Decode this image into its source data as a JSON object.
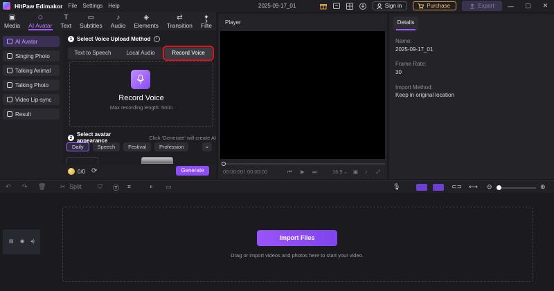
{
  "app": {
    "name": "HitPaw Edimakor",
    "menu": [
      "File",
      "Settings",
      "Help"
    ],
    "document_title": "2025-09-17_01",
    "sign_in_label": "Sign in",
    "purchase_label": "Purchase",
    "export_label": "Export"
  },
  "tool_tabs": [
    {
      "label": "Media",
      "icon": "media-icon"
    },
    {
      "label": "AI Avatar",
      "icon": "ai-avatar-icon",
      "active": true
    },
    {
      "label": "Text",
      "icon": "text-icon"
    },
    {
      "label": "Subtitles",
      "icon": "subtitles-icon"
    },
    {
      "label": "Audio",
      "icon": "audio-icon"
    },
    {
      "label": "Elements",
      "icon": "elements-icon"
    },
    {
      "label": "Transition",
      "icon": "transition-icon"
    },
    {
      "label": "Filte",
      "icon": "filter-icon"
    }
  ],
  "sidebar": {
    "items": [
      {
        "label": "AI Avatar",
        "active": true
      },
      {
        "label": "Singing Photo"
      },
      {
        "label": "Talking Animal"
      },
      {
        "label": "Talking Photo"
      },
      {
        "label": "Video Lip-sync"
      },
      {
        "label": "Result"
      }
    ]
  },
  "avatar_panel": {
    "step1_number": "1",
    "step1_title": "Select Voice Upload Method",
    "methods": [
      "Text to Speech",
      "Local Audio",
      "Record Voice"
    ],
    "selected_method": "Record Voice",
    "record_title": "Record Voice",
    "record_subtitle": "Max recording length: 5min",
    "step2_number": "2",
    "step2_title": "Select avatar appearance",
    "step2_hint": "Click 'Generate' will create AI",
    "categories": [
      "Daily",
      "Speech",
      "Festival",
      "Profession"
    ],
    "active_category": "Daily",
    "credits": "0/0",
    "generate_label": "Generate"
  },
  "player": {
    "title": "Player",
    "current_time": "00:00:00",
    "total_time": "00:00:00",
    "aspect_ratio": "16:9"
  },
  "details": {
    "tab_label": "Details",
    "fields": [
      {
        "label": "Name:",
        "value": "2025-09-17_01"
      },
      {
        "label": "Frame Rate:",
        "value": "30"
      },
      {
        "label": "Import Method:",
        "value": "Keep in original location"
      }
    ]
  },
  "timeline": {
    "split_label": "Split",
    "import_label": "Import Files",
    "drop_hint": "Drag or import videos and photos here to start your video."
  },
  "colors": {
    "accent": "#8e4df4",
    "highlight_box": "#e0151f",
    "purchase_gold": "#d8a24d"
  }
}
